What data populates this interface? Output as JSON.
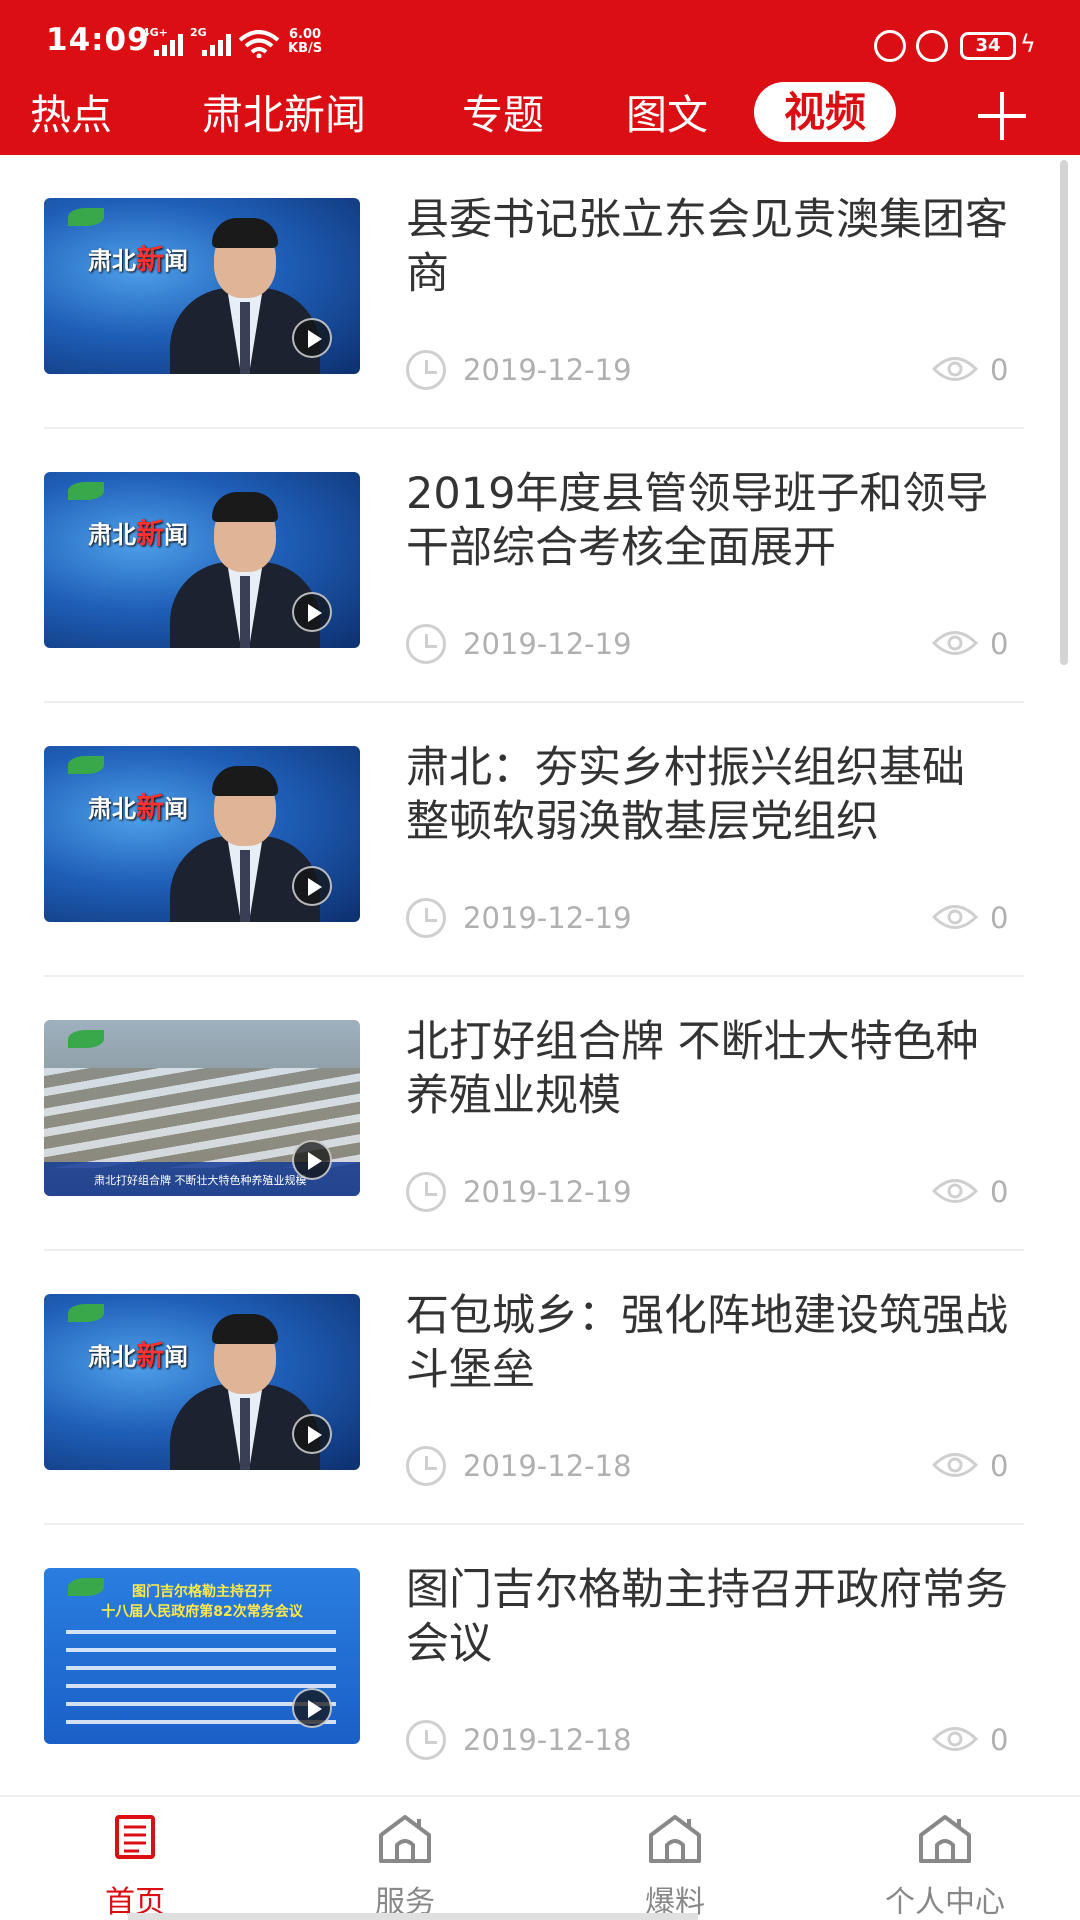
{
  "status_bar": {
    "time": "14:09",
    "signal1_tag": "4G+",
    "signal2_tag": "2G",
    "speed_value": "6.00",
    "speed_unit": "KB/S",
    "battery": "34"
  },
  "tabs": [
    {
      "label": "热点",
      "active": false
    },
    {
      "label": "肃北新闻",
      "active": false
    },
    {
      "label": "专题",
      "active": false
    },
    {
      "label": "图文",
      "active": false
    },
    {
      "label": "视频",
      "active": true
    }
  ],
  "thumbnails": {
    "logo_prefix": "肃北",
    "logo_red": "新",
    "logo_suffix": "闻",
    "farm_caption": "肃北打好组合牌 不断壮大特色种养殖业规模",
    "doc_title_line1": "图门吉尔格勒主持召开",
    "doc_title_line2": "十八届人民政府第82次常务会议"
  },
  "news": [
    {
      "title": "县委书记张立东会见贵澳集团客商",
      "date": "2019-12-19",
      "views": "0"
    },
    {
      "title": "2019年度县管领导班子和领导干部综合考核全面展开",
      "date": "2019-12-19",
      "views": "0"
    },
    {
      "title": "肃北：夯实乡村振兴组织基础 整顿软弱涣散基层党组织",
      "date": "2019-12-19",
      "views": "0"
    },
    {
      "title": "北打好组合牌 不断壮大特色种养殖业规模",
      "date": "2019-12-19",
      "views": "0"
    },
    {
      "title": "石包城乡：强化阵地建设筑强战斗堡垒",
      "date": "2019-12-18",
      "views": "0"
    },
    {
      "title": "图门吉尔格勒主持召开政府常务会议",
      "date": "2019-12-18",
      "views": "0"
    }
  ],
  "bottom_nav": [
    {
      "label": "首页",
      "icon": "newspaper-icon",
      "active": true
    },
    {
      "label": "服务",
      "icon": "house-icon",
      "active": false
    },
    {
      "label": "爆料",
      "icon": "house-icon",
      "active": false
    },
    {
      "label": "个人中心",
      "icon": "house-icon",
      "active": false
    }
  ],
  "colors": {
    "brand_red": "#db0e14",
    "title_text": "#333333",
    "meta_text": "#b0b0b0",
    "nav_inactive": "#888888"
  }
}
